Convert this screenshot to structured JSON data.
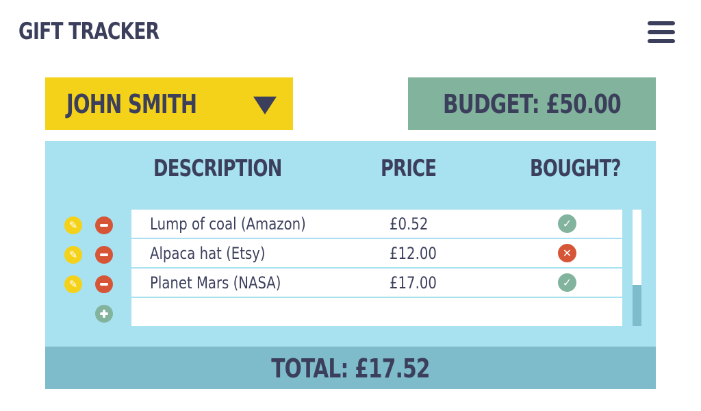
{
  "header": {
    "title": "GIFT TRACKER",
    "menu_icon": "hamburger-menu-icon"
  },
  "person": {
    "selected": "JOHN SMITH",
    "dropdown_icon": "triangle-down-icon"
  },
  "budget": {
    "label": "BUDGET: £50.00"
  },
  "table": {
    "columns": [
      "DESCRIPTION",
      "PRICE",
      "BOUGHT?"
    ],
    "rows": [
      {
        "description": "Lump of coal (Amazon)",
        "price": "£0.52",
        "bought": true
      },
      {
        "description": "Alpaca hat (Etsy)",
        "price": "£12.00",
        "bought": false
      },
      {
        "description": "Planet Mars (NASA)",
        "price": "£17.00",
        "bought": true
      }
    ],
    "add_icon": "plus-icon",
    "edit_icon": "pencil-icon",
    "delete_icon": "minus-icon"
  },
  "total": {
    "label": "TOTAL: £17.52"
  },
  "colors": {
    "accent_yellow": "#f5d21a",
    "accent_green": "#82b39c",
    "panel_blue": "#a8e1ef",
    "total_blue": "#7fbccb",
    "delete_red": "#d65537",
    "text_navy": "#3b3f5c"
  }
}
